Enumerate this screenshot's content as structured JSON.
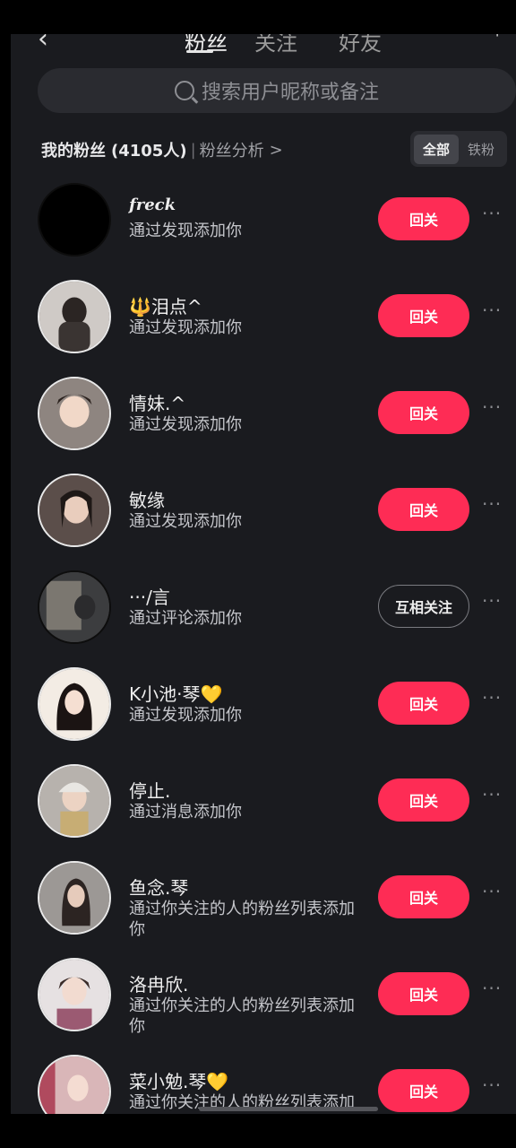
{
  "header": {
    "tabs": [
      {
        "label": "粉丝",
        "active": true
      },
      {
        "label": "关注",
        "active": false
      },
      {
        "label": "好友",
        "active": false
      }
    ]
  },
  "search": {
    "placeholder": "搜索用户昵称或备注",
    "icon": "search-icon"
  },
  "fans": {
    "title": "我的粉丝",
    "count": "(4105人)",
    "separator": "|",
    "analysis_label": "粉丝分析",
    "chevron": ">"
  },
  "filter": {
    "options": [
      "全部",
      "铁粉"
    ],
    "selected": "全部"
  },
  "colors": {
    "accent": "#fe2c55",
    "background": "#1a1b1f"
  },
  "followers": [
    {
      "name": "freck",
      "source": "通过发现添加你",
      "button": "回关",
      "more": "···"
    },
    {
      "name": "🔱泪点^",
      "source": "通过发现添加你",
      "button": "回关",
      "more": "···"
    },
    {
      "name": "情妹.^",
      "source": "通过发现添加你",
      "button": "回关",
      "more": "···"
    },
    {
      "name": "敏缘",
      "source": "通过发现添加你",
      "button": "回关",
      "more": "···"
    },
    {
      "name": "···/言",
      "source": "通过评论添加你",
      "button": "互相关注",
      "more": "···"
    },
    {
      "name": "K小池·琴💛",
      "source": "通过发现添加你",
      "button": "回关",
      "more": "···"
    },
    {
      "name": "停止.",
      "source": "通过消息添加你",
      "button": "回关",
      "more": "···"
    },
    {
      "name": "鱼念.琴",
      "source": "通过你关注的人的粉丝列表添加你",
      "button": "回关",
      "more": "···"
    },
    {
      "name": "洛冉欣.",
      "source": "通过你关注的人的粉丝列表添加你",
      "button": "回关",
      "more": "···"
    },
    {
      "name": "菜小勉.琴💛",
      "source": "通过你关注的人的粉丝列表添加你",
      "button": "回关",
      "more": "···"
    }
  ]
}
